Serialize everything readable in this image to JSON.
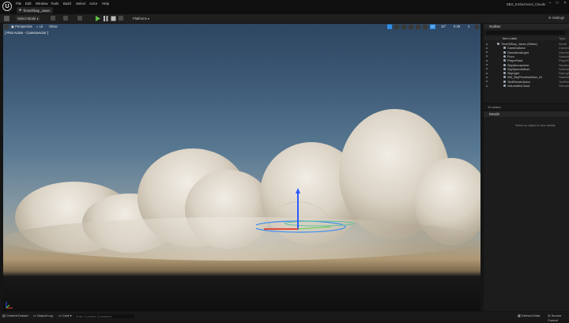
{
  "app": {
    "logo_text": "U",
    "name": "SBG_EmberVoxel_Clouds",
    "project_tab": "TimeOfDay_Jason"
  },
  "menu": [
    "File",
    "Edit",
    "Window",
    "Tools",
    "Build",
    "Select",
    "Actor",
    "Help"
  ],
  "toolbar": {
    "select_mode": "Select Mode",
    "platforms": "Platforms"
  },
  "viewport": {
    "perspective": "Perspective",
    "lit": "Lit",
    "show": "Show",
    "pilot_label": "[ Pilot Active - CameraActor ]",
    "grid_value": "10",
    "angle_value": "10°",
    "scale_value": "0.25",
    "camera_speed": "4"
  },
  "outliner": {
    "title": "Outliner",
    "column_label": "Item Label",
    "column_type": "Type",
    "items": [
      {
        "label": "TimeOfDay_Jason (Editor)",
        "type": "World"
      },
      {
        "label": "CameraActor",
        "type": "CameraActor"
      },
      {
        "label": "DirectionalLight",
        "type": "DirectionalLight"
      },
      {
        "label": "Floor",
        "type": "StaticMeshActor"
      },
      {
        "label": "PlayerStart",
        "type": "PlayerStart"
      },
      {
        "label": "SkyAtmosphere",
        "type": "SkyAtmosphere"
      },
      {
        "label": "SkySphereMesh",
        "type": "StaticMeshActor"
      },
      {
        "label": "SkyLight",
        "type": "SkyLight"
      },
      {
        "label": "SM_SkyPreviewMesh_01",
        "type": "StaticMeshActor"
      },
      {
        "label": "TextRenderActor",
        "type": "TextRenderActor"
      },
      {
        "label": "VolumetricCloud",
        "type": "VolumetricCloud"
      }
    ]
  },
  "actors_count": "10 actors",
  "details": {
    "title": "Details",
    "hint": "Select an object to view details."
  },
  "statusbar": {
    "content_drawer": "Content Drawer",
    "output_log": "Output Log",
    "cmd": "Cmd",
    "cmd_placeholder": "Enter Console Command",
    "derived_data": "Derived Data",
    "source_control": "Source Control"
  },
  "colors": {
    "accent": "#2f8ee6",
    "play": "#5fbf3f"
  },
  "icons": [
    "save-icon",
    "play-icon",
    "pause-icon",
    "stop-icon",
    "grid-icon",
    "settings-icon"
  ]
}
